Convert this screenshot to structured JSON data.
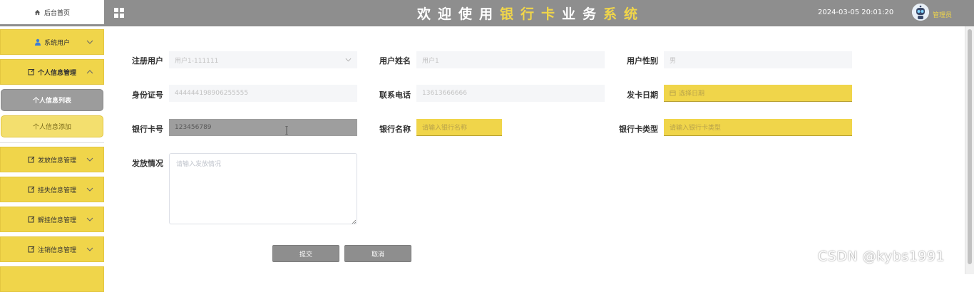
{
  "header": {
    "home_label": "后台首页",
    "title_white_1": "欢迎使用",
    "title_accent": "银行卡",
    "title_white_2": "业务",
    "title_accent_2": "系统",
    "datetime": "2024-03-05 20:01:20",
    "username": "管理员",
    "accent_color": "#f0d54a",
    "bar_color": "#8e8e8e"
  },
  "sidebar": {
    "items": [
      {
        "label": "系统用户",
        "icon": "user-icon"
      },
      {
        "label": "个人信息管理",
        "icon": "edit-icon"
      },
      {
        "label": "发放信息管理",
        "icon": "edit-icon"
      },
      {
        "label": "挂失信息管理",
        "icon": "edit-icon"
      },
      {
        "label": "解挂信息管理",
        "icon": "edit-icon"
      },
      {
        "label": "注销信息管理",
        "icon": "edit-icon"
      }
    ],
    "sub_items": [
      {
        "label": "个人信息列表"
      },
      {
        "label": "个人信息添加"
      }
    ]
  },
  "form": {
    "register_user": {
      "label": "注册用户",
      "value": "用户1-111111"
    },
    "user_name": {
      "label": "用户姓名",
      "value": "用户1"
    },
    "gender": {
      "label": "用户性别",
      "value": "男"
    },
    "id_number": {
      "label": "身份证号",
      "value": "444444198906255555"
    },
    "phone": {
      "label": "联系电话",
      "value": "13613666666"
    },
    "issue_date": {
      "label": "发卡日期",
      "placeholder": "选择日期"
    },
    "card_number": {
      "label": "银行卡号",
      "value": "123456789"
    },
    "bank_name": {
      "label": "银行名称",
      "placeholder": "请输入银行名称"
    },
    "card_type": {
      "label": "银行卡类型",
      "placeholder": "请输入银行卡类型"
    },
    "issuance": {
      "label": "发放情况",
      "placeholder": "请输入发放情况"
    }
  },
  "buttons": {
    "submit": "提交",
    "cancel": "取消"
  },
  "watermark": "CSDN @kybs1991"
}
